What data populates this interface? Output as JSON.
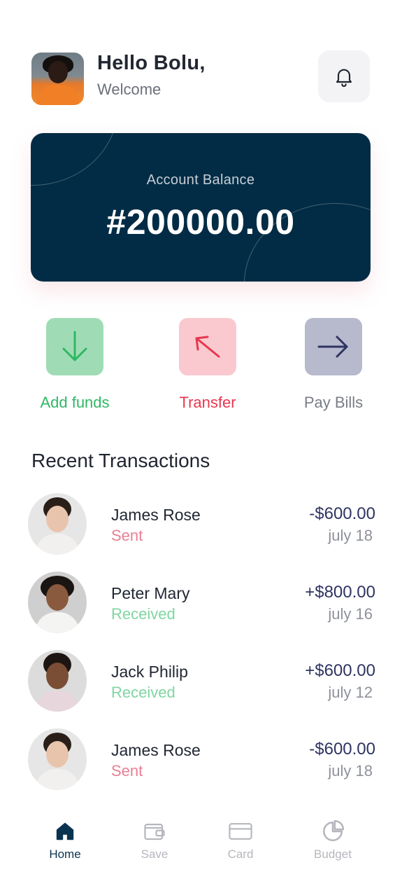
{
  "header": {
    "greeting": "Hello Bolu,",
    "subtitle": "Welcome",
    "avatar_icon": "user-avatar",
    "notification_icon": "bell-icon"
  },
  "balance": {
    "label": "Account Balance",
    "amount": "#200000.00"
  },
  "actions": [
    {
      "label": "Add funds",
      "icon": "arrow-down-icon",
      "color": "#2fb865",
      "bg": "#9fdcb5"
    },
    {
      "label": "Transfer",
      "icon": "arrow-up-left-icon",
      "color": "#e8374f",
      "bg": "#f9c9cf"
    },
    {
      "label": "Pay Bills",
      "icon": "arrow-right-icon",
      "color": "#2f3462",
      "bg": "#b7b9cd"
    }
  ],
  "transactions": {
    "title": "Recent Transactions",
    "items": [
      {
        "name": "James Rose",
        "status": "Sent",
        "amount": "-$600.00",
        "date": "july 18"
      },
      {
        "name": "Peter Mary",
        "status": "Received",
        "amount": "+$800.00",
        "date": "july 16"
      },
      {
        "name": "Jack Philip",
        "status": "Received",
        "amount": "+$600.00",
        "date": "july 12"
      },
      {
        "name": "James Rose",
        "status": "Sent",
        "amount": "-$600.00",
        "date": "july 18"
      }
    ]
  },
  "nav": {
    "items": [
      {
        "label": "Home",
        "icon": "home-icon",
        "active": true
      },
      {
        "label": "Save",
        "icon": "wallet-icon",
        "active": false
      },
      {
        "label": "Card",
        "icon": "card-icon",
        "active": false
      },
      {
        "label": "Budget",
        "icon": "pie-chart-icon",
        "active": false
      }
    ]
  },
  "colors": {
    "primary": "#022c45",
    "sent": "#ea7f92",
    "received": "#7fd6a2",
    "amount": "#2f3462"
  }
}
